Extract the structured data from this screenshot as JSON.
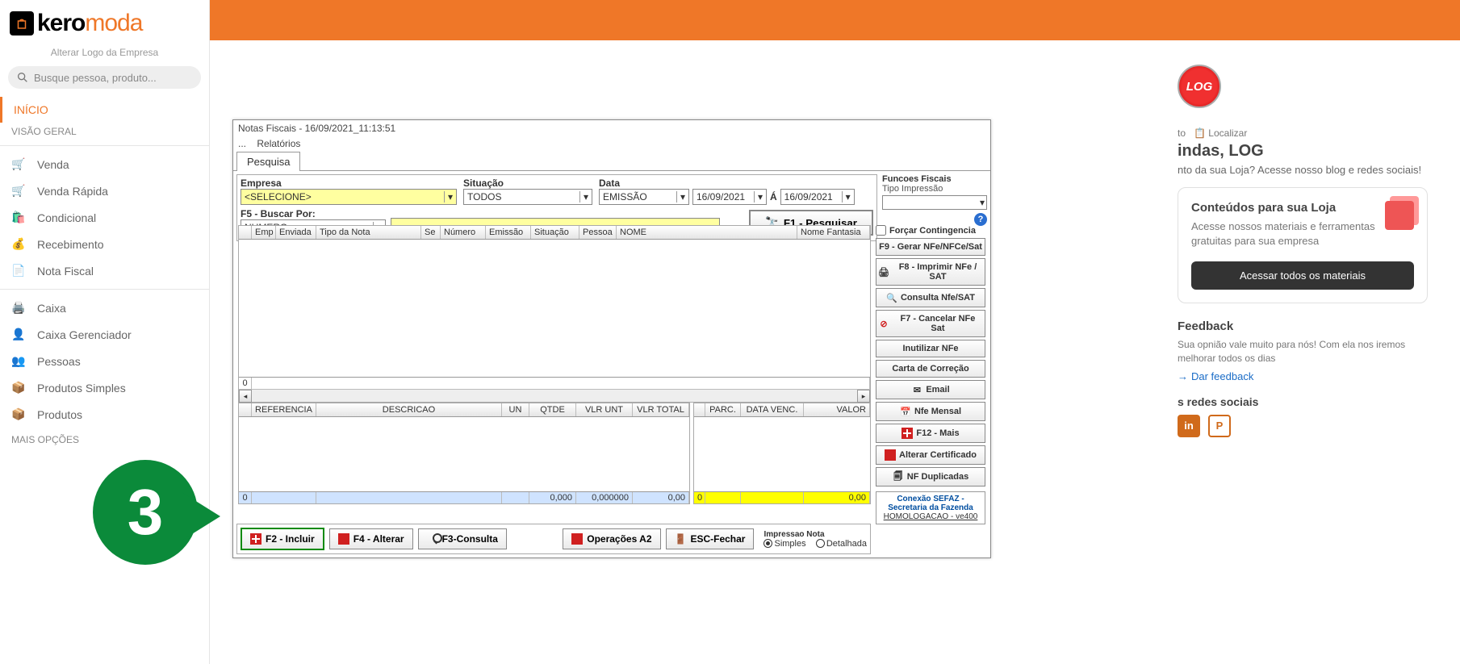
{
  "sidebar": {
    "alterar_logo": "Alterar Logo da Empresa",
    "search_placeholder": "Busque pessoa, produto...",
    "inicio": "INÍCIO",
    "visao_geral": "VISÃO GERAL",
    "items": [
      {
        "label": "Venda"
      },
      {
        "label": "Venda Rápida"
      },
      {
        "label": "Condicional"
      },
      {
        "label": "Recebimento"
      },
      {
        "label": "Nota Fiscal"
      }
    ],
    "items2": [
      {
        "label": "Caixa"
      },
      {
        "label": "Caixa Gerenciador"
      },
      {
        "label": "Pessoas"
      },
      {
        "label": "Produtos Simples"
      },
      {
        "label": "Produtos"
      }
    ],
    "mais_opcoes": "MAIS OPÇÕES"
  },
  "right": {
    "localizar": "Localizar",
    "to_label": "to",
    "welcome": "indas, LOG",
    "welcome_sub": "nto da sua Loja? Acesse nosso blog e redes sociais!",
    "card_title": "Conteúdos para sua Loja",
    "card_text": "Acesse nossos materiais e ferramentas gratuitas para sua empresa",
    "card_btn": "Acessar todos os materiais",
    "feedback_title": "Feedback",
    "feedback_text": "Sua opnião vale muito para nós! Com ela nos iremos melhorar todos os dias",
    "feedback_link": "Dar feedback",
    "social_title": "s redes sociais"
  },
  "win": {
    "title": "Notas Fiscais - 16/09/2021_11:13:51",
    "menu_dots": "...",
    "menu_rel": "Relatórios",
    "tab": "Pesquisa",
    "empresa_label": "Empresa",
    "empresa_val": "<SELECIONE>",
    "situacao_label": "Situação",
    "situacao_val": "TODOS",
    "data_label": "Data",
    "data_type": "EMISSÃO",
    "date1": "16/09/2021",
    "date_sep": "Á",
    "date2": "16/09/2021",
    "buscar_label": "F5 - Buscar Por:",
    "buscar_val": "NUMERO",
    "pesquisar": "F1 - Pesquisar",
    "funcoes": "Funcoes Fiscais",
    "tipo_imp": "Tipo Impressão",
    "forcar": "Forçar Contingencia",
    "sb": [
      "F9 - Gerar NFe/NFCe/Sat",
      "F8 - Imprimir NFe  /  SAT",
      "Consulta Nfe/SAT",
      "F7  -  Cancelar NFe Sat",
      "Inutilizar NFe",
      "Carta de Correção",
      "Email",
      "Nfe Mensal",
      "F12 - Mais",
      "Alterar Certificado",
      "NF Duplicadas"
    ],
    "conexao1": "Conexão SEFAZ - Secretaria da Fazenda",
    "conexao2": "HOMOLOGACAO - ve400",
    "grid_headers": [
      "",
      "Emp",
      "Enviada",
      "Tipo da Nota",
      "Se",
      "Número",
      "Emissão",
      "Situação",
      "Pessoa",
      "NOME",
      "Nome Fantasia"
    ],
    "grid_foot0": "0",
    "sub1_headers": [
      "",
      "REFERENCIA",
      "DESCRICAO",
      "UN",
      "QTDE",
      "VLR UNT",
      "VLR TOTAL"
    ],
    "sub1_foot": [
      "0",
      "",
      "",
      "",
      "0,000",
      "0,000000",
      "0,00"
    ],
    "sub2_headers": [
      "",
      "PARC.",
      "DATA VENC.",
      "VALOR"
    ],
    "sub2_foot": [
      "0",
      "",
      "",
      "0,00"
    ],
    "bb": [
      "F2 - Incluir",
      "F4 - Alterar",
      "F3-Consulta",
      "Operações A2",
      "ESC-Fechar"
    ],
    "imp_label": "Impressao Nota",
    "imp_opt1": "Simples",
    "imp_opt2": "Detalhada"
  },
  "step": "3"
}
